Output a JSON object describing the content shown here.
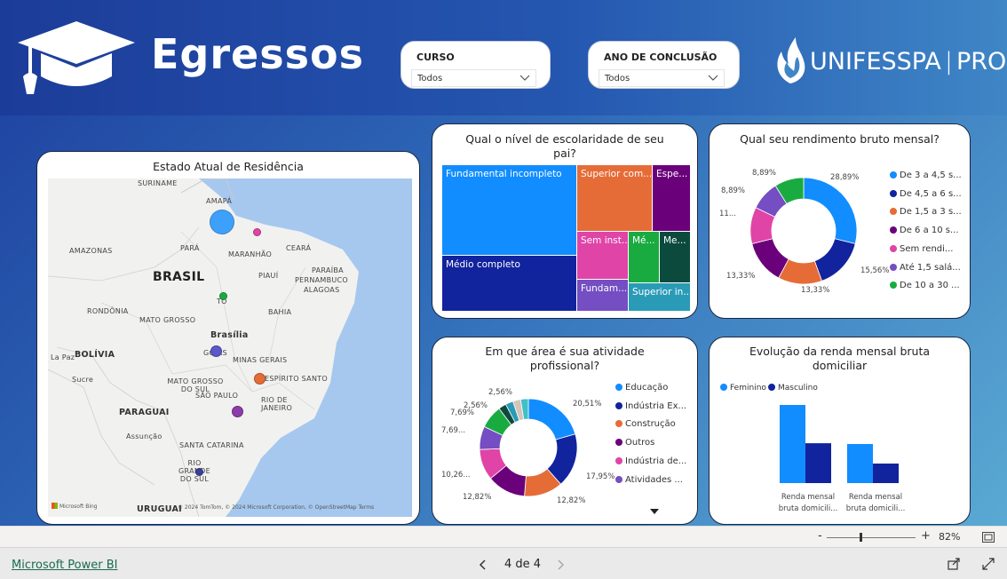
{
  "header": {
    "brand": "Egressos",
    "uni_logo": "UNIFESSPA | PROEG"
  },
  "slicers": [
    {
      "label": "CURSO",
      "value": "Todos"
    },
    {
      "label": "ANO DE CONCLUSÃO",
      "value": "Todos"
    }
  ],
  "map": {
    "title": "Estado Atual de Residência",
    "labels": [
      "SURINAME",
      "AMAPÁ",
      "AMAZONAS",
      "PARÁ",
      "MARANHÃO",
      "CEARÁ",
      "BRASIL",
      "PIAUÍ",
      "PARAÍBA",
      "PERNAMBUCO",
      "ALAGOAS",
      "RONDÔNIA",
      "TO",
      "BAHIA",
      "MATO GROSSO",
      "Brasília",
      "GOIÁS",
      "MINAS GERAIS",
      "La Paz",
      "BOLÍVIA",
      "Sucre",
      "MATO GROSSO DO SUL",
      "ESPÍRITO SANTO",
      "SÃO PAULO",
      "RIO DE JANEIRO",
      "PARAGUAI",
      "Assunção",
      "SANTA CATARINA",
      "RIO GRANDE DO SUL",
      "URUGUAI"
    ],
    "attribution": "© 2024 TomTom, © 2024 Microsoft Corporation, © OpenStreetMap  Terms",
    "bing": "Microsoft Bing"
  },
  "treemap": {
    "title": "Qual o nível de escolaridade de seu pai?",
    "cells": [
      "Fundamental incompleto",
      "Médio completo",
      "Superior com...",
      "Espe...",
      "Sem inst...",
      "Mé...",
      "Me...",
      "Fundam...",
      "Superior in..."
    ],
    "colors": [
      "#118dff",
      "#12239e",
      "#e66c37",
      "#6b007b",
      "#e044a7",
      "#1aab40",
      "#0d4a3e",
      "#744ec2",
      "#2a9bb7"
    ]
  },
  "rendimento": {
    "title": "Qual seu rendimento bruto mensal?",
    "legend": [
      "De 3 a 4,5 s...",
      "De 4,5 a 6 s...",
      "De 1,5 a 3 s...",
      "De 6 a 10 s...",
      "Sem rendi...",
      "Até 1,5 salá...",
      "De 10 a 30 ..."
    ],
    "values": [
      28.89,
      15.56,
      13.33,
      13.33,
      11.11,
      8.89,
      8.89
    ],
    "value_labels": [
      "28,89%",
      "15,56%",
      "13,33%",
      "13,33%",
      "11...",
      "8,89%",
      "8,89%"
    ],
    "colors": [
      "#118dff",
      "#12239e",
      "#e66c37",
      "#6b007b",
      "#e044a7",
      "#744ec2",
      "#1aab40"
    ]
  },
  "area": {
    "title": "Em que área é sua atividade profissional?",
    "legend": [
      "Educação",
      "Indústria Ex...",
      "Construção",
      "Outros",
      "Indústria de...",
      "Atividades ..."
    ],
    "values": [
      20.51,
      17.95,
      12.82,
      12.82,
      10.26,
      7.69,
      7.69,
      2.56,
      2.56,
      2.56,
      2.56
    ],
    "value_labels": [
      "20,51%",
      "17,95%",
      "12,82%",
      "12,82%",
      "10,26...",
      "7,69...",
      "7,69%",
      "2,56%",
      "2,56%"
    ],
    "colors": [
      "#118dff",
      "#12239e",
      "#e66c37",
      "#6b007b",
      "#e044a7",
      "#744ec2",
      "#1aab40",
      "#0d4a3e",
      "#2a9bb7",
      "#d6c4b9",
      "#3fc0c9"
    ]
  },
  "evolucao": {
    "title": "Evolução da renda mensal bruta domiciliar",
    "legend": [
      "Feminino",
      "Masculino"
    ],
    "colors": [
      "#118dff",
      "#12239e"
    ],
    "categories": [
      "Renda mensal bruta domicili...",
      "Renda mensal bruta domicili..."
    ],
    "chart_data": {
      "type": "bar",
      "categories": [
        "Renda mensal bruta domicili...",
        "Renda mensal bruta domicili..."
      ],
      "series": [
        {
          "name": "Feminino",
          "values": [
            100,
            50
          ]
        },
        {
          "name": "Masculino",
          "values": [
            51,
            25
          ]
        }
      ]
    }
  },
  "zoom": {
    "level": "82%"
  },
  "footer": {
    "powerbi": "Microsoft Power BI",
    "page": "4 de 4"
  }
}
